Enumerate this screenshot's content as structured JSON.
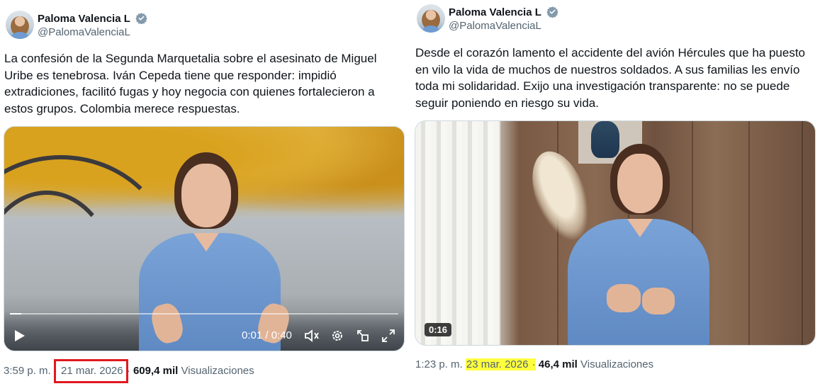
{
  "tweets": [
    {
      "author_name": "Paloma Valencia L",
      "author_handle": "@PalomaValenciaL",
      "verified_icon": "verified-badge-icon",
      "text": "La confesión de la Segunda Marquetalia sobre el asesinato de Miguel\nUribe es tenebrosa. Iván Cepeda tiene que responder: impidió\nextradiciones, facilitó fugas y hoy negocia con quienes fortalecieron a\nestos grupos. Colombia merece respuestas.",
      "video": {
        "current_time": "0:01 / 0:40",
        "progress_fraction": 0.03,
        "controls": [
          "play-icon",
          "volume-icon",
          "settings-icon",
          "popout-icon",
          "fullscreen-icon"
        ]
      },
      "time": "3:59 p. m.",
      "separator": "·",
      "date": "21 mar. 2026",
      "views_count": "609,4 mil",
      "views_label": "Visualizaciones",
      "date_marker": "red-box"
    },
    {
      "author_name": "Paloma Valencia L",
      "author_handle": "@PalomaValenciaL",
      "verified_icon": "verified-badge-icon",
      "text": "Desde el corazón lamento el accidente del avión Hércules que ha puesto\nen vilo la vida de muchos de nuestros soldados. A sus familias les envío\ntoda mi solidaridad. Exijo una investigación transparente: no se puede\nseguir poniendo en riesgo su vida.",
      "video": {
        "duration": "0:16"
      },
      "time": "1:23 p. m.",
      "separator": "·",
      "date": "23 mar. 2026",
      "views_count": "46,4 mil",
      "views_label": "Visualizaciones",
      "date_marker": "yellow-highlight"
    }
  ],
  "colors": {
    "text_primary": "#0f1419",
    "text_secondary": "#536471",
    "verified_blue": "#829aab",
    "red_box": "#e0191f",
    "highlight_yellow": "#ffff3d"
  }
}
